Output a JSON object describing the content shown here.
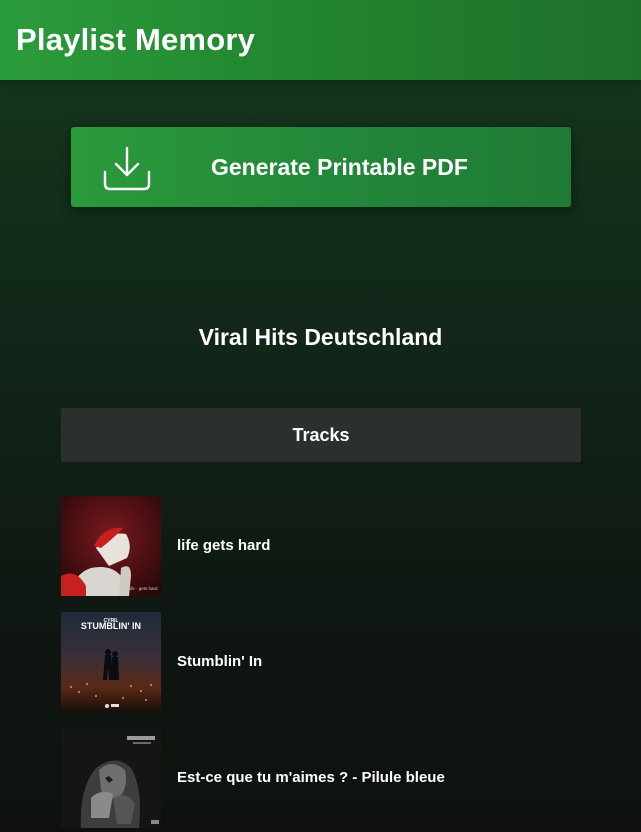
{
  "app": {
    "title": "Playlist Memory"
  },
  "actions": {
    "generate_pdf_label": "Generate Printable PDF",
    "icon": "download-icon"
  },
  "playlist": {
    "name": "Viral Hits Deutschland"
  },
  "tracks_section": {
    "header": "Tracks"
  },
  "tracks": [
    {
      "title": "life gets hard",
      "cover_text": "life · gets hard"
    },
    {
      "title": "Stumblin' In",
      "cover_text": "STUMBLIN' IN",
      "cover_artist": "CYRIL"
    },
    {
      "title": "Est-ce que tu m'aimes ? - Pilule bleue"
    }
  ],
  "colors": {
    "accent": "#2b9c3c",
    "header_bg": "#2c302d"
  }
}
